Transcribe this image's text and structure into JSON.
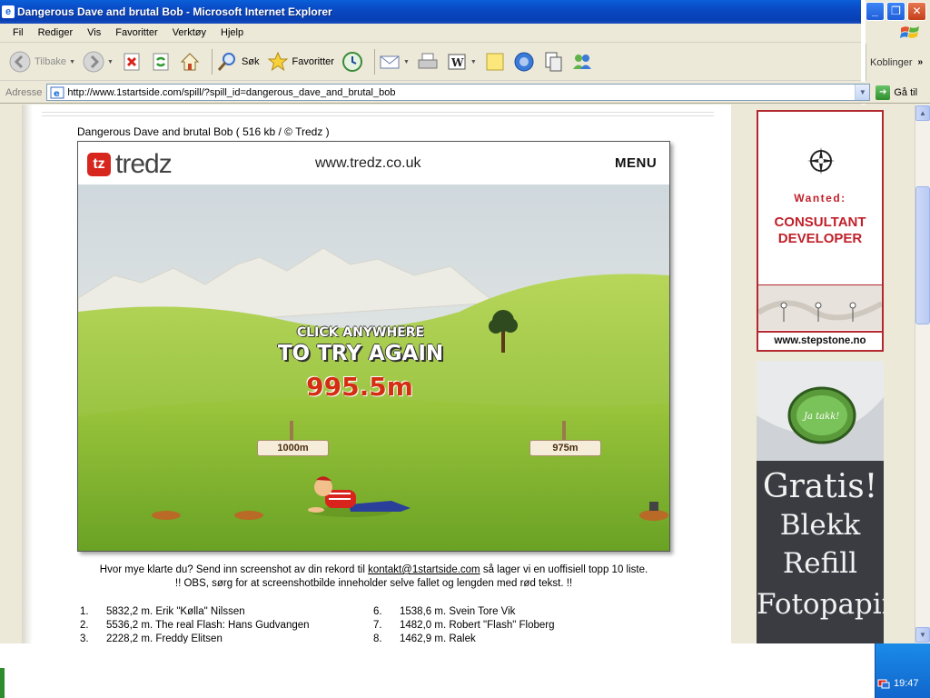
{
  "window": {
    "title": "Dangerous Dave and brutal Bob - Microsoft Internet Explorer",
    "buttons": {
      "minimize": "_",
      "restore": "❐",
      "close": "✕"
    }
  },
  "menubar": {
    "items": [
      "Fil",
      "Rediger",
      "Vis",
      "Favoritter",
      "Verktøy",
      "Hjelp"
    ]
  },
  "toolbar": {
    "back": "Tilbake",
    "search": "Søk",
    "favorites": "Favoritter",
    "links": "Koblinger",
    "links_chevron": "»"
  },
  "address": {
    "label": "Adresse",
    "url": "http://www.1startside.com/spill/?spill_id=dangerous_dave_and_brutal_bob",
    "go": "Gå til"
  },
  "content": {
    "game_title": "Dangerous Dave and brutal Bob ( 516 kb / © Tredz )",
    "game": {
      "logo_mark": "tz",
      "logo_word": "tredz",
      "site_url": "www.tredz.co.uk",
      "menu": "MENU",
      "click_anywhere": "CLICK ANYWHERE",
      "try_again": "TO TRY AGAIN",
      "distance": "995.5m",
      "sign_left": "1000m",
      "sign_right": "975m"
    },
    "info_line1_before": "Hvor mye klarte du? Send inn screenshot av din rekord til ",
    "info_email": "kontakt@1startside.com",
    "info_line1_after": " så lager vi en uoffisiell topp 10 liste.",
    "info_line2": "!! OBS, sørg for at screenshotbilde inneholder selve fallet og lengden med rød tekst. !!",
    "top_list": [
      {
        "rank": "1.",
        "entry": "5832,2 m. Erik \"Kølla\" Nilssen"
      },
      {
        "rank": "2.",
        "entry": "5536,2 m. The real Flash: Hans Gudvangen"
      },
      {
        "rank": "3.",
        "entry": "2228,2 m. Freddy Elitsen"
      },
      {
        "rank": "6.",
        "entry": "1538,6 m. Svein Tore Vik"
      },
      {
        "rank": "7.",
        "entry": "1482,0 m. Robert \"Flash\" Floberg"
      },
      {
        "rank": "8.",
        "entry": "1462,9 m. Ralek"
      }
    ]
  },
  "ads": {
    "stepstone": {
      "wanted": "Wanted:",
      "role_line1": "CONSULTANT",
      "role_line2": "DEVELOPER",
      "url": "www.stepstone.no"
    },
    "blekk": {
      "button": "Ja takk!",
      "line1": "Gratis!",
      "line2": "Blekk",
      "line3": "Refill",
      "line4": "Fotopapir"
    }
  },
  "tray": {
    "clock": "19:47"
  },
  "colors": {
    "title_bar": "#0a49c4",
    "ad_red": "#c0202a",
    "distance_red": "#d32e12",
    "grass": "#7cb82f"
  }
}
